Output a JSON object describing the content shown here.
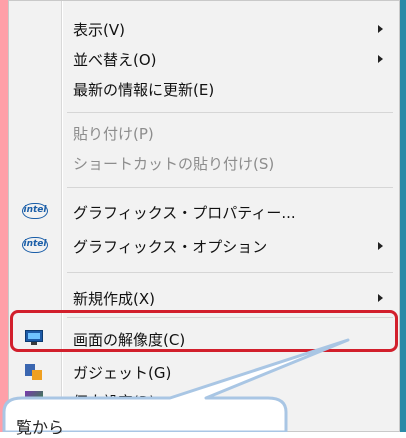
{
  "menu": {
    "items": [
      {
        "label": "表示(V)",
        "submenu": true
      },
      {
        "label": "並べ替え(O)",
        "submenu": true
      },
      {
        "label": "最新の情報に更新(E)",
        "submenu": false
      },
      {
        "label": "貼り付け(P)",
        "submenu": false,
        "disabled": true
      },
      {
        "label": "ショートカットの貼り付け(S)",
        "submenu": false,
        "disabled": true
      },
      {
        "label": "グラフィックス・プロパティー...",
        "icon": "intel-logo-icon"
      },
      {
        "label": "グラフィックス・オプション",
        "icon": "intel-logo-icon",
        "submenu": true
      },
      {
        "label": "新規作成(X)",
        "submenu": true
      },
      {
        "label": "画面の解像度(C)",
        "icon": "display-icon"
      },
      {
        "label": "ガジェット(G)",
        "icon": "gadget-icon"
      },
      {
        "label": "個人設定(R)",
        "icon": "personalize-icon"
      }
    ],
    "intel_icon_text": "intel"
  },
  "callout": {
    "text": "覧から"
  },
  "colors": {
    "highlight": "#d21f2c",
    "menu_bg": "#f2f2f2",
    "disabled_text": "#8d8d8d"
  }
}
